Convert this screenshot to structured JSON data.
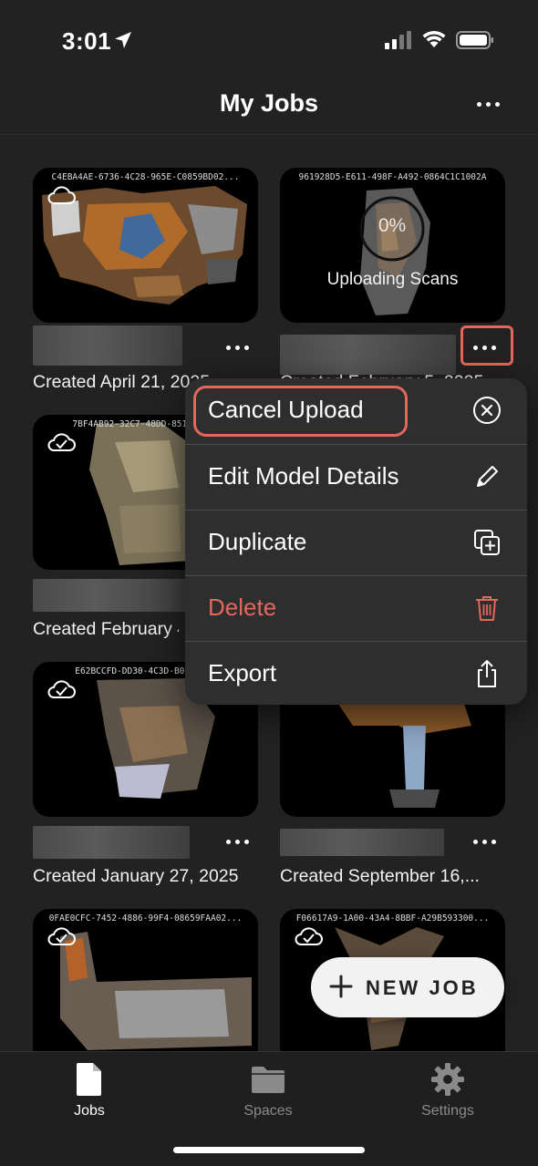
{
  "status_bar": {
    "time": "3:01"
  },
  "header": {
    "title": "My Jobs"
  },
  "jobs": [
    {
      "id": "C4EBA4AE-6736-4C28-965E-C0859BD02...",
      "created": "Created April 21, 2025"
    },
    {
      "id": "961928D5-E611-498F-A492-0864C1C1002A",
      "created": "Created February 5, 2025",
      "progress": "0%",
      "status": "Uploading Scans"
    },
    {
      "id": "7BF4AB92-32C7-48DD-851E-5...",
      "created": "Created February 4"
    },
    {
      "id": "",
      "created": ""
    },
    {
      "id": "E62BCCFD-DD30-4C3D-B06E-...",
      "created": "Created January 27, 2025"
    },
    {
      "id": "",
      "created": "Created September 16,..."
    },
    {
      "id": "0FAE0CFC-7452-4886-99F4-08659FAA02...",
      "created": ""
    },
    {
      "id": "F06617A9-1A00-43A4-8BBF-A29B593300...",
      "created": ""
    }
  ],
  "menu": {
    "items": [
      {
        "label": "Cancel Upload",
        "icon": "x-circle-icon"
      },
      {
        "label": "Edit Model Details",
        "icon": "pencil-icon"
      },
      {
        "label": "Duplicate",
        "icon": "duplicate-icon"
      },
      {
        "label": "Delete",
        "icon": "trash-icon"
      },
      {
        "label": "Export",
        "icon": "share-icon"
      }
    ],
    "danger_color": "#e4675c"
  },
  "fab": {
    "label": "NEW JOB"
  },
  "tabs": [
    {
      "label": "Jobs",
      "icon": "document-icon",
      "active": true
    },
    {
      "label": "Spaces",
      "icon": "folder-icon",
      "active": false
    },
    {
      "label": "Settings",
      "icon": "gear-icon",
      "active": false
    }
  ],
  "colors": {
    "background": "#222222",
    "highlight": "#e4675c"
  }
}
